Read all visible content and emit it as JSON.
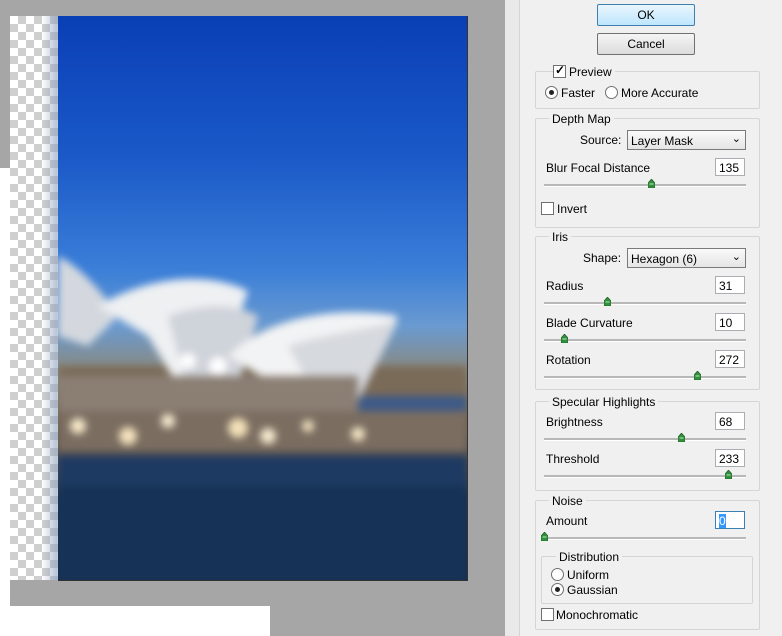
{
  "buttons": {
    "ok": "OK",
    "cancel": "Cancel"
  },
  "preview": {
    "checkbox_label": "Preview",
    "checked": true,
    "faster": "Faster",
    "more_accurate": "More Accurate",
    "selected": "Faster"
  },
  "depth_map": {
    "title": "Depth Map",
    "source_label": "Source:",
    "source_value": "Layer Mask",
    "blur_focal_label": "Blur Focal Distance",
    "blur_focal_value": "135",
    "blur_focal_level": 0.53,
    "invert_label": "Invert",
    "invert_checked": false
  },
  "iris": {
    "title": "Iris",
    "shape_label": "Shape:",
    "shape_value": "Hexagon (6)",
    "radius_label": "Radius",
    "radius_value": "31",
    "radius_level": 0.31,
    "blade_label": "Blade Curvature",
    "blade_value": "10",
    "blade_level": 0.1,
    "rotation_label": "Rotation",
    "rotation_value": "272",
    "rotation_level": 0.755
  },
  "specular": {
    "title": "Specular Highlights",
    "brightness_label": "Brightness",
    "brightness_value": "68",
    "brightness_level": 0.68,
    "threshold_label": "Threshold",
    "threshold_value": "233",
    "threshold_level": 0.913
  },
  "noise": {
    "title": "Noise",
    "amount_label": "Amount",
    "amount_value": "0",
    "amount_level": 0,
    "distribution_title": "Distribution",
    "uniform": "Uniform",
    "gaussian": "Gaussian",
    "selected": "Gaussian",
    "mono_label": "Monochromatic",
    "mono_checked": false
  },
  "colors": {
    "slider_thumb": "#2f8f3a",
    "accent": "#3c7fb1"
  }
}
